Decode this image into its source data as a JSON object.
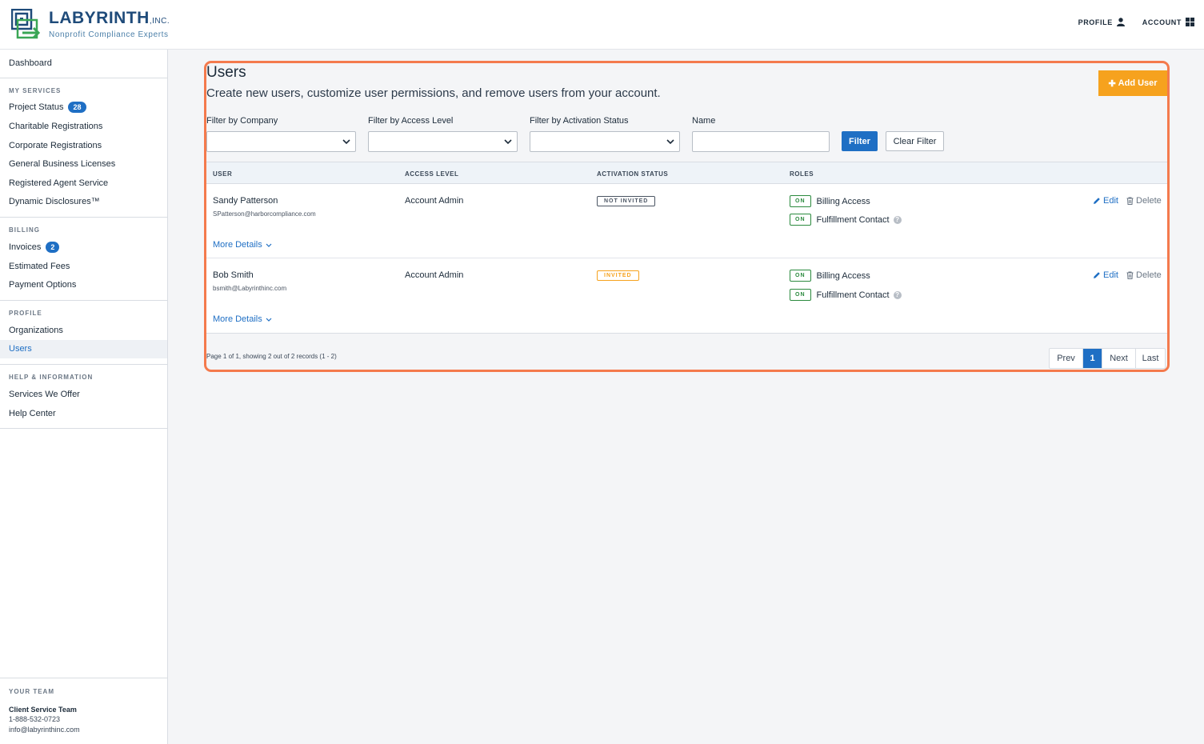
{
  "brand": {
    "name": "LABYRINTH",
    "suffix": ",INC.",
    "tagline": "Nonprofit Compliance Experts",
    "colors": {
      "primary": "#1f4b7a",
      "accent_green": "#3aa655"
    }
  },
  "top_nav": {
    "profile_label": "PROFILE",
    "account_label": "ACCOUNT"
  },
  "sidebar": {
    "dashboard": "Dashboard",
    "my_services": {
      "heading": "MY SERVICES",
      "items": [
        {
          "label": "Project Status",
          "badge": "28"
        },
        {
          "label": "Charitable Registrations"
        },
        {
          "label": "Corporate Registrations"
        },
        {
          "label": "General Business Licenses"
        },
        {
          "label": "Registered Agent Service"
        },
        {
          "label": "Dynamic Disclosures™"
        }
      ]
    },
    "billing": {
      "heading": "BILLING",
      "items": [
        {
          "label": "Invoices",
          "badge": "2"
        },
        {
          "label": "Estimated Fees"
        },
        {
          "label": "Payment Options"
        }
      ]
    },
    "profile": {
      "heading": "PROFILE",
      "items": [
        {
          "label": "Organizations"
        },
        {
          "label": "Users",
          "active": true
        }
      ]
    },
    "help": {
      "heading": "HELP & INFORMATION",
      "items": [
        {
          "label": "Services We Offer"
        },
        {
          "label": "Help Center"
        }
      ]
    },
    "team": {
      "heading": "YOUR TEAM",
      "name": "Client Service Team",
      "phone": "1-888-532-0723",
      "email": "info@labyrinthinc.com"
    }
  },
  "main": {
    "title": "Users",
    "subtitle": "Create new users, customize user permissions, and remove users from your account.",
    "add_user_label": "Add User",
    "filters": {
      "company_label": "Filter by Company",
      "access_label": "Filter by Access Level",
      "activation_label": "Filter by Activation Status",
      "name_label": "Name",
      "name_value": "",
      "filter_button": "Filter",
      "clear_button": "Clear Filter"
    },
    "table": {
      "columns": [
        "USER",
        "ACCESS LEVEL",
        "ACTIVATION STATUS",
        "ROLES"
      ],
      "rows": [
        {
          "name": "Sandy Patterson",
          "email": "SPatterson@harborcompliance.com",
          "access": "Account Admin",
          "status": "NOT INVITED",
          "roles": [
            {
              "state": "ON",
              "label": "Billing Access"
            },
            {
              "state": "ON",
              "label": "Fulfillment Contact"
            }
          ],
          "edit": "Edit",
          "delete": "Delete",
          "more": "More Details"
        },
        {
          "name": "Bob Smith",
          "email": "bsmith@Labyrinthinc.com",
          "access": "Account Admin",
          "status": "INVITED",
          "roles": [
            {
              "state": "ON",
              "label": "Billing Access"
            },
            {
              "state": "ON",
              "label": "Fulfillment Contact"
            }
          ],
          "edit": "Edit",
          "delete": "Delete",
          "more": "More Details"
        }
      ]
    },
    "records_text": "Page 1 of 1, showing 2 out of 2 records (1 - 2)",
    "pager": {
      "prev": "Prev",
      "current": "1",
      "next": "Next",
      "last": "Last"
    }
  }
}
